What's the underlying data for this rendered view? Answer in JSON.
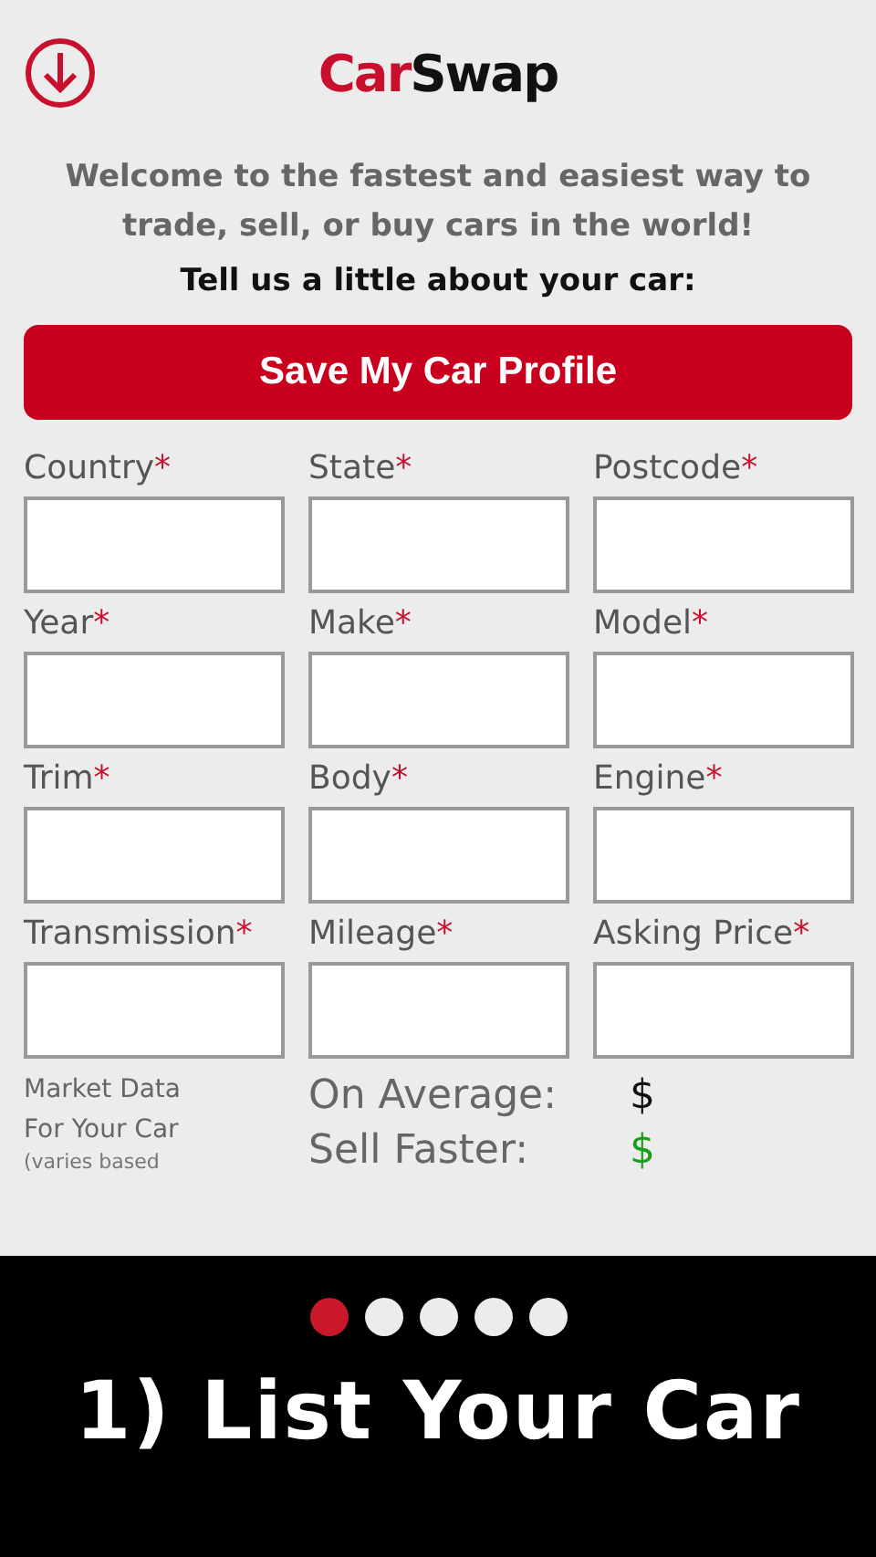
{
  "header": {
    "logo": {
      "part_1": "Car",
      "part_2": "Swap"
    }
  },
  "intro": "Welcome to the fastest and easiest way to trade, sell, or buy cars in the world!",
  "prompt": "Tell us a little about your car:",
  "save_button": "Save My Car Profile",
  "fields": [
    {
      "label": "Country",
      "required_mark": "*"
    },
    {
      "label": "State",
      "required_mark": "*"
    },
    {
      "label": "Postcode",
      "required_mark": "*"
    },
    {
      "label": "Year",
      "required_mark": "*"
    },
    {
      "label": "Make",
      "required_mark": "*"
    },
    {
      "label": "Model",
      "required_mark": "*"
    },
    {
      "label": "Trim",
      "required_mark": "*"
    },
    {
      "label": "Body",
      "required_mark": "*"
    },
    {
      "label": "Engine",
      "required_mark": "*"
    },
    {
      "label": "Transmission",
      "required_mark": "*"
    },
    {
      "label": "Mileage",
      "required_mark": "*"
    },
    {
      "label": "Asking Price",
      "required_mark": "*"
    }
  ],
  "market": {
    "title": "Market Data For Your Car",
    "note": "(varies based",
    "rows": [
      {
        "label": "On Average:",
        "value": "$",
        "color": "#111111"
      },
      {
        "label": "Sell Faster:",
        "value": "$",
        "color": "#1a9e1a"
      }
    ]
  },
  "pager": [
    {
      "selected": true
    },
    {
      "selected": false
    },
    {
      "selected": false
    },
    {
      "selected": false
    },
    {
      "selected": false
    }
  ],
  "caption": "1) List Your Car"
}
